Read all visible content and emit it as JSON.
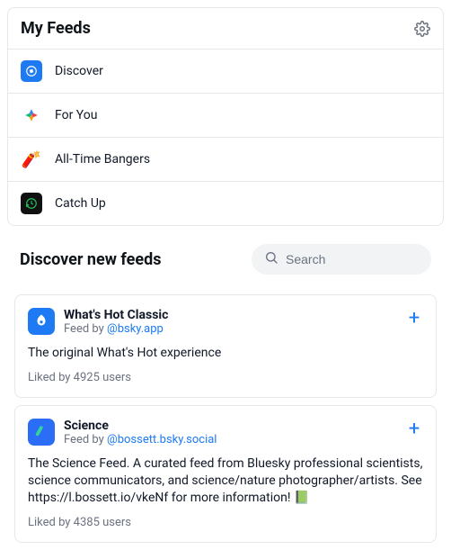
{
  "myFeeds": {
    "title": "My Feeds",
    "items": [
      {
        "label": "Discover"
      },
      {
        "label": "For You"
      },
      {
        "label": "All-Time Bangers"
      },
      {
        "label": "Catch Up"
      }
    ]
  },
  "discover": {
    "title": "Discover new feeds",
    "search": {
      "placeholder": "Search"
    }
  },
  "cards": [
    {
      "name": "What's Hot Classic",
      "bylinePrefix": "Feed by ",
      "handle": "@bsky.app",
      "desc": "The original What's Hot experience",
      "likes": "Liked by 4925 users"
    },
    {
      "name": "Science",
      "bylinePrefix": "Feed by ",
      "handle": "@bossett.bsky.social",
      "desc": "The Science Feed. A curated feed from Bluesky professional scientists, science communicators, and science/nature photographer/artists. See https://l.bossett.io/vkeNf for more information! 📗",
      "likes": "Liked by 4385 users"
    }
  ]
}
